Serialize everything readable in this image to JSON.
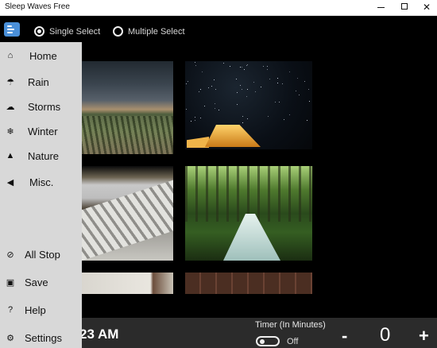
{
  "window": {
    "title": "Sleep Waves Free"
  },
  "titlebar": {
    "minimize": "",
    "maximize": "",
    "close": "✕"
  },
  "selection": {
    "single": "Single Select",
    "multiple": "Multiple Select",
    "selected": "single"
  },
  "menu": {
    "top": [
      {
        "label": "Home",
        "icon": "home-icon",
        "glyph": "⌂"
      },
      {
        "label": "Rain",
        "icon": "rain-icon",
        "glyph": "☂"
      },
      {
        "label": "Storms",
        "icon": "storm-icon",
        "glyph": "☁"
      },
      {
        "label": "Winter",
        "icon": "snowflake-icon",
        "glyph": "❄"
      },
      {
        "label": "Nature",
        "icon": "nature-icon",
        "glyph": "▲"
      },
      {
        "label": "Misc.",
        "icon": "speaker-icon",
        "glyph": "◀"
      }
    ],
    "bottom": [
      {
        "label": "All Stop",
        "icon": "stop-icon",
        "glyph": "⊘"
      },
      {
        "label": "Save",
        "icon": "save-icon",
        "glyph": "▣"
      },
      {
        "label": "Help",
        "icon": "help-icon",
        "glyph": "?"
      },
      {
        "label": "Settings",
        "icon": "gear-icon",
        "glyph": "⚙"
      }
    ]
  },
  "clock": {
    "time": "23 AM"
  },
  "timer": {
    "label": "Timer (In Minutes)",
    "toggle_state": "Off",
    "minus": "-",
    "value": "0",
    "plus": "+"
  }
}
